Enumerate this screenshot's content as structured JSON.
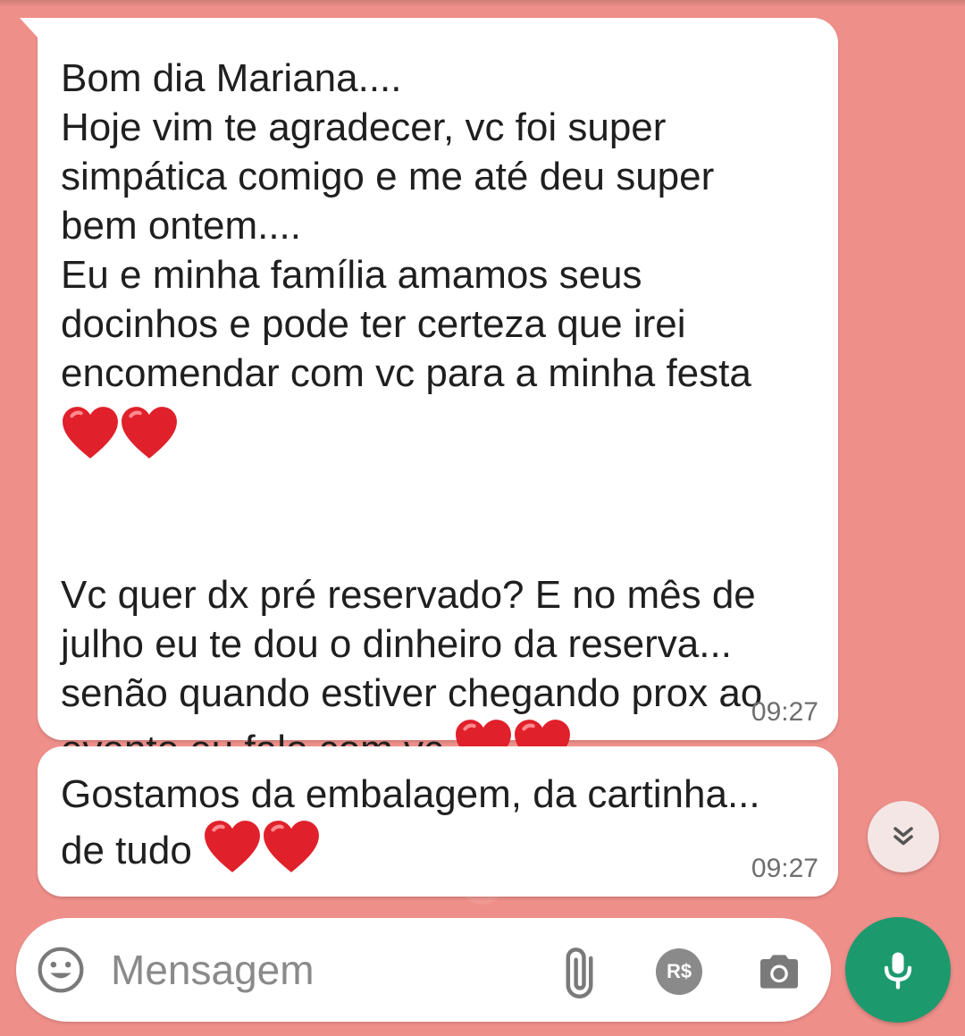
{
  "colors": {
    "wallpaper": "#ef8f8a",
    "bubble": "#ffffff",
    "timestamp": "#6e6e6e",
    "heart": "#e0202a",
    "mic_button": "#1c9a6e"
  },
  "messages": [
    {
      "paragraph1": "Bom dia Mariana....\nHoje vim te agradecer, vc foi super\nsimpática comigo e me até deu super\nbem ontem....\nEu e minha família amamos seus\ndocinhos e pode ter certeza que irei\nencomendar com vc para a minha festa",
      "paragraph2": "Vc quer dx pré reservado? E no mês de\njulho eu te dou o dinheiro da reserva...\nsenão quando estiver chegando prox ao\nevento eu falo com vc",
      "time": "09:27"
    },
    {
      "text": "Gostamos da embalagem, da cartinha...\nde tudo",
      "time": "09:27"
    }
  ],
  "input": {
    "placeholder": "Mensagem",
    "pay_label": "R$"
  },
  "icons": {
    "emoji": "emoji-icon",
    "attach": "paperclip-icon",
    "pay": "payment-icon",
    "camera": "camera-icon",
    "mic": "microphone-icon",
    "scroll": "double-chevron-down-icon",
    "heart": "red-heart-emoji"
  }
}
